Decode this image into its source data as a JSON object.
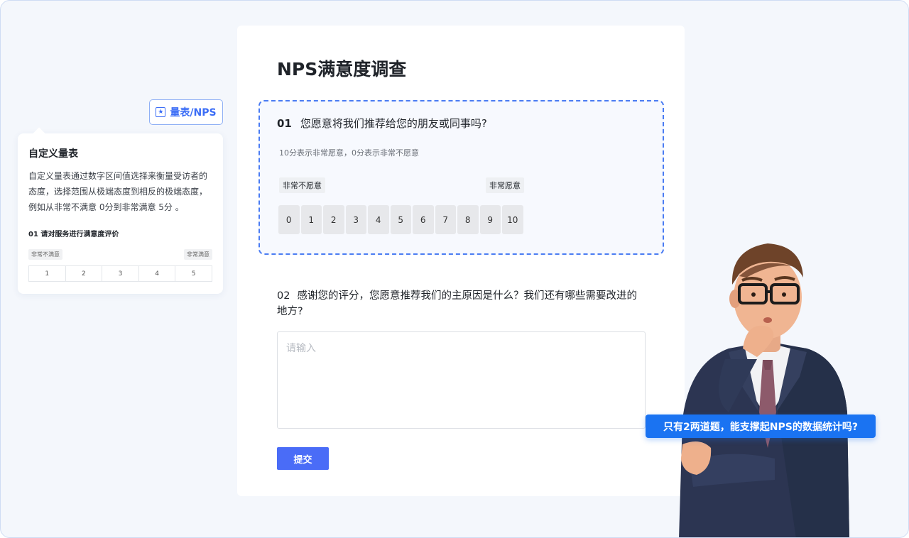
{
  "tag_button": {
    "label": "量表/NPS",
    "icon": "star-square-icon"
  },
  "side_card": {
    "title": "自定义量表",
    "description": "自定义量表通过数字区间值选择来衡量受访者的态度，选择范围从极端态度到相反的极端态度，例如从非常不满意 0分到非常满意 5分 。",
    "question": "01  请对服务进行满意度评价",
    "low_label": "非常不满意",
    "high_label": "非常满意",
    "scale": [
      "1",
      "2",
      "3",
      "4",
      "5"
    ]
  },
  "survey": {
    "title": "NPS满意度调查",
    "q1": {
      "num": "01",
      "text": "您愿意将我们推荐给您的朋友或同事吗?",
      "hint": "10分表示非常愿意，0分表示非常不愿意",
      "low_label": "非常不愿意",
      "high_label": "非常愿意",
      "scale": [
        "0",
        "1",
        "2",
        "3",
        "4",
        "5",
        "6",
        "7",
        "8",
        "9",
        "10"
      ]
    },
    "q2": {
      "num": "02",
      "text": "感谢您的评分，您愿意推荐我们的主原因是什么？我们还有哪些需要改进的地方?",
      "placeholder": "请输入"
    },
    "submit_label": "提交"
  },
  "speech_bubble": "只有2两道题，能支撑起NPS的数据统计吗?",
  "colors": {
    "accent": "#4a6cf7",
    "dashed_border": "#4a7cf3",
    "bubble": "#1a73f2",
    "background": "#f4f7fc"
  }
}
